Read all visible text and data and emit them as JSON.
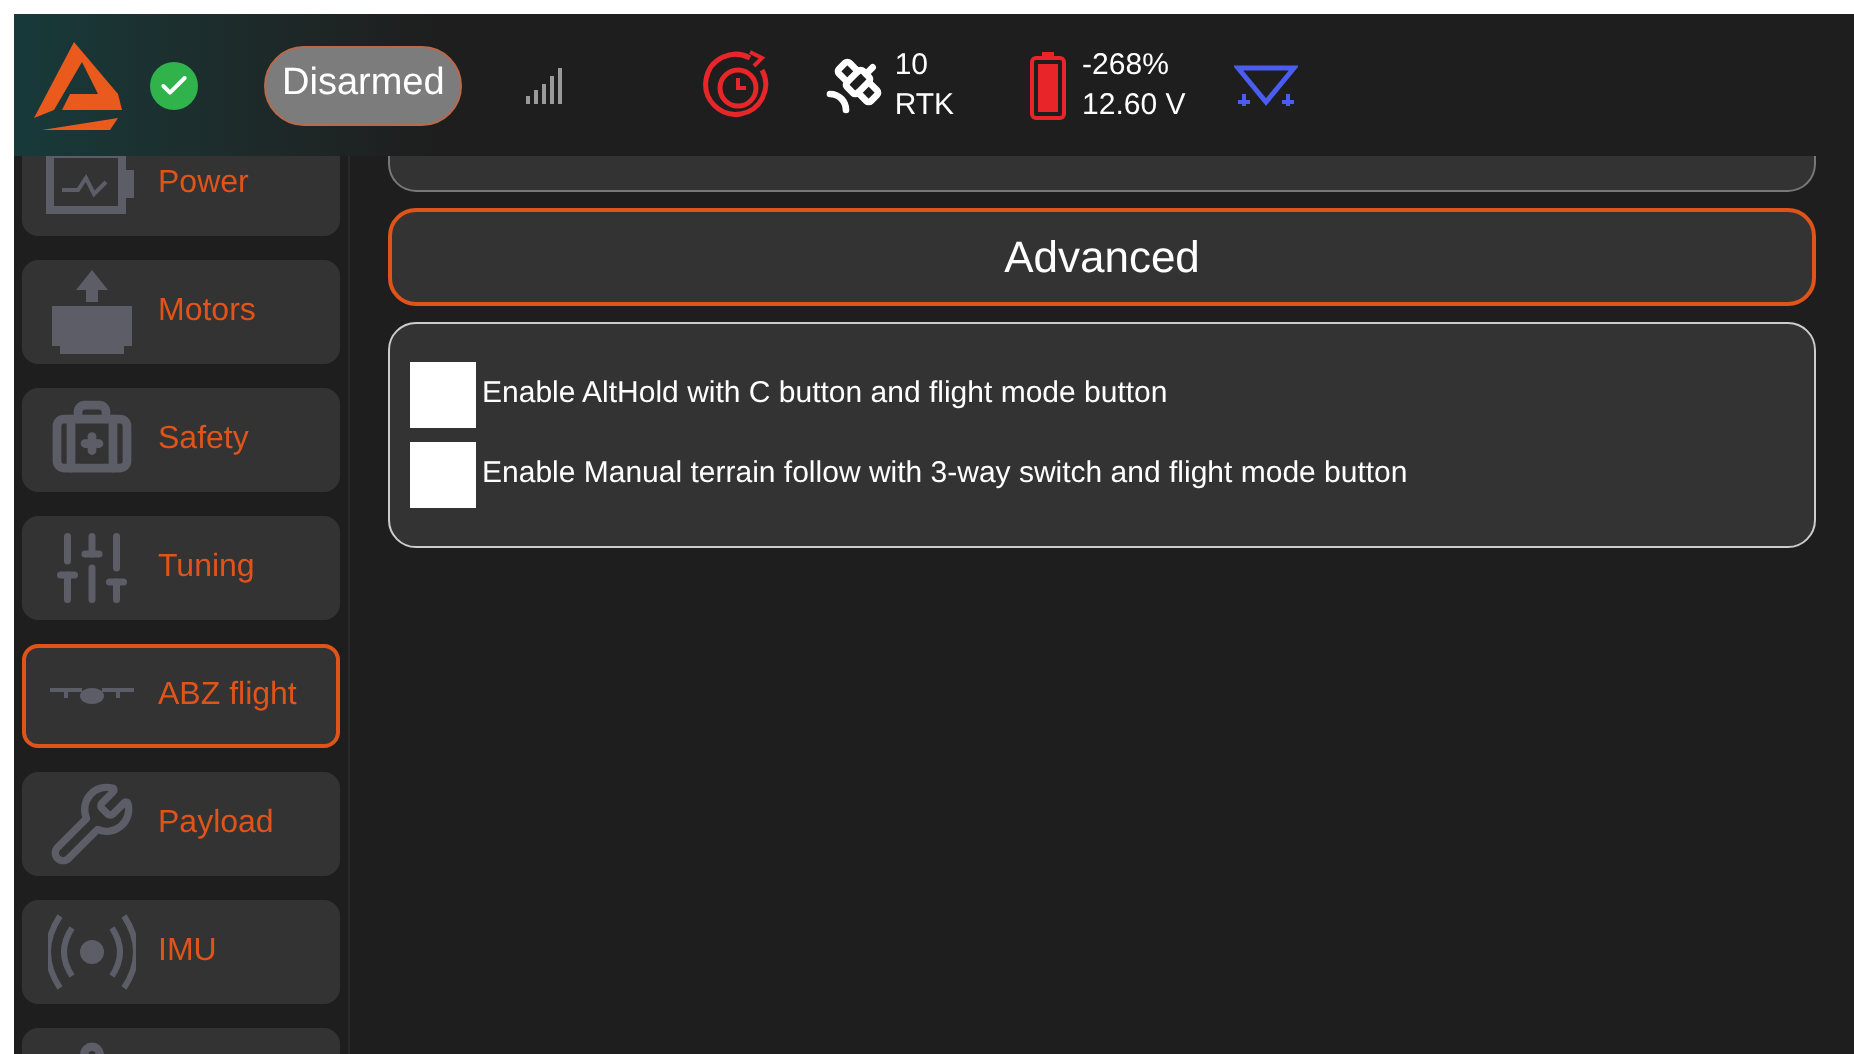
{
  "top_bar": {
    "status_ok": true,
    "arm_state": "Disarmed",
    "satellites": {
      "count": "10",
      "fix": "RTK"
    },
    "battery": {
      "percent": "-268%",
      "voltage": "12.60 V"
    }
  },
  "sidebar": {
    "items": [
      {
        "kind": "power",
        "label": "Power",
        "selected": false
      },
      {
        "kind": "motors",
        "label": "Motors",
        "selected": false
      },
      {
        "kind": "safety",
        "label": "Safety",
        "selected": false
      },
      {
        "kind": "tuning",
        "label": "Tuning",
        "selected": false
      },
      {
        "kind": "drone",
        "label": "ABZ flight",
        "selected": true
      },
      {
        "kind": "payload",
        "label": "Payload",
        "selected": false
      },
      {
        "kind": "imu",
        "label": "IMU",
        "selected": false
      },
      {
        "kind": "settings",
        "selected": false
      }
    ]
  },
  "content": {
    "section_button": "Advanced",
    "options": [
      {
        "label": "Enable AltHold with C button and flight mode button",
        "checked": false
      },
      {
        "label": "Enable Manual terrain follow with 3-way switch and flight mode button",
        "checked": false
      }
    ]
  }
}
